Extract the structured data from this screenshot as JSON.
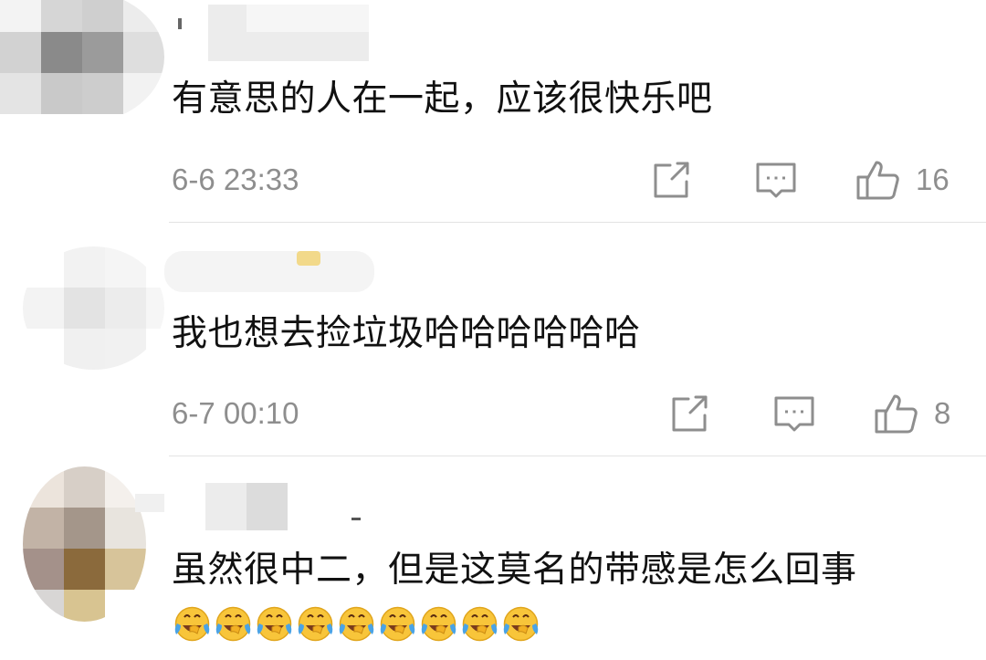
{
  "comments": [
    {
      "text": "有意思的人在一起，应该很快乐吧",
      "time": "6-6 23:33",
      "likes": "16",
      "avatar_colors": [
        "#f3f3f3",
        "#d6d6d6",
        "#cfcfcf",
        "#ececec",
        "#d2d2d2",
        "#8a8a8a",
        "#9b9b9b",
        "#dedede",
        "#e4e4e4",
        "#c9c9c9",
        "#cdcdcd",
        "#f2f2f2"
      ]
    },
    {
      "text": "我也想去捡垃圾哈哈哈哈哈哈",
      "time": "6-7 00:10",
      "likes": "8",
      "avatar_colors": [
        "#ffffff",
        "#f2f2f2",
        "#f5f5f5",
        "#ffffff",
        "#f3f3f3",
        "#e3e3e3",
        "#ececec",
        "#f6f6f6",
        "#ffffff",
        "#f0f0f0",
        "#f1f1f1",
        "#ffffff"
      ]
    },
    {
      "text": "虽然很中二，但是这莫名的带感是怎么回事",
      "emoji_name": "crying-laughing-emoji",
      "emoji_count": 9,
      "avatar_colors": [
        "#ece4dc",
        "#d7cfc7",
        "#f4f0ec",
        "#c2b3a6",
        "#a4968a",
        "#e8e4de",
        "#a4918a",
        "#8b6a3c",
        "#d7c49a",
        "#d8d6d5",
        "#d8c491",
        "#ffffff"
      ]
    }
  ],
  "icons": {
    "share": "share-icon",
    "reply": "comment-icon",
    "like": "thumbs-up-icon"
  },
  "colors": {
    "text": "#111111",
    "meta": "#8e8e8e",
    "divider": "#e3e3e3",
    "icon": "#8e8e8e"
  }
}
